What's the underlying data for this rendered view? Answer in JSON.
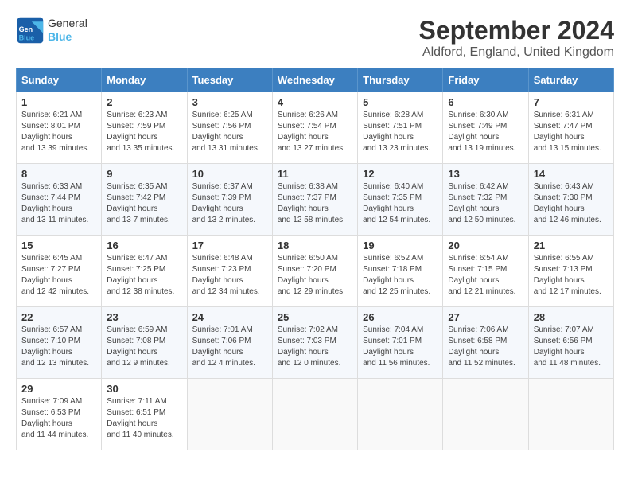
{
  "header": {
    "logo_line1": "General",
    "logo_line2": "Blue",
    "title": "September 2024",
    "subtitle": "Aldford, England, United Kingdom"
  },
  "calendar": {
    "days_of_week": [
      "Sunday",
      "Monday",
      "Tuesday",
      "Wednesday",
      "Thursday",
      "Friday",
      "Saturday"
    ],
    "weeks": [
      [
        {
          "day": "1",
          "sunrise": "6:21 AM",
          "sunset": "8:01 PM",
          "daylight": "13 hours and 39 minutes."
        },
        {
          "day": "2",
          "sunrise": "6:23 AM",
          "sunset": "7:59 PM",
          "daylight": "13 hours and 35 minutes."
        },
        {
          "day": "3",
          "sunrise": "6:25 AM",
          "sunset": "7:56 PM",
          "daylight": "13 hours and 31 minutes."
        },
        {
          "day": "4",
          "sunrise": "6:26 AM",
          "sunset": "7:54 PM",
          "daylight": "13 hours and 27 minutes."
        },
        {
          "day": "5",
          "sunrise": "6:28 AM",
          "sunset": "7:51 PM",
          "daylight": "13 hours and 23 minutes."
        },
        {
          "day": "6",
          "sunrise": "6:30 AM",
          "sunset": "7:49 PM",
          "daylight": "13 hours and 19 minutes."
        },
        {
          "day": "7",
          "sunrise": "6:31 AM",
          "sunset": "7:47 PM",
          "daylight": "13 hours and 15 minutes."
        }
      ],
      [
        {
          "day": "8",
          "sunrise": "6:33 AM",
          "sunset": "7:44 PM",
          "daylight": "13 hours and 11 minutes."
        },
        {
          "day": "9",
          "sunrise": "6:35 AM",
          "sunset": "7:42 PM",
          "daylight": "13 hours and 7 minutes."
        },
        {
          "day": "10",
          "sunrise": "6:37 AM",
          "sunset": "7:39 PM",
          "daylight": "13 hours and 2 minutes."
        },
        {
          "day": "11",
          "sunrise": "6:38 AM",
          "sunset": "7:37 PM",
          "daylight": "12 hours and 58 minutes."
        },
        {
          "day": "12",
          "sunrise": "6:40 AM",
          "sunset": "7:35 PM",
          "daylight": "12 hours and 54 minutes."
        },
        {
          "day": "13",
          "sunrise": "6:42 AM",
          "sunset": "7:32 PM",
          "daylight": "12 hours and 50 minutes."
        },
        {
          "day": "14",
          "sunrise": "6:43 AM",
          "sunset": "7:30 PM",
          "daylight": "12 hours and 46 minutes."
        }
      ],
      [
        {
          "day": "15",
          "sunrise": "6:45 AM",
          "sunset": "7:27 PM",
          "daylight": "12 hours and 42 minutes."
        },
        {
          "day": "16",
          "sunrise": "6:47 AM",
          "sunset": "7:25 PM",
          "daylight": "12 hours and 38 minutes."
        },
        {
          "day": "17",
          "sunrise": "6:48 AM",
          "sunset": "7:23 PM",
          "daylight": "12 hours and 34 minutes."
        },
        {
          "day": "18",
          "sunrise": "6:50 AM",
          "sunset": "7:20 PM",
          "daylight": "12 hours and 29 minutes."
        },
        {
          "day": "19",
          "sunrise": "6:52 AM",
          "sunset": "7:18 PM",
          "daylight": "12 hours and 25 minutes."
        },
        {
          "day": "20",
          "sunrise": "6:54 AM",
          "sunset": "7:15 PM",
          "daylight": "12 hours and 21 minutes."
        },
        {
          "day": "21",
          "sunrise": "6:55 AM",
          "sunset": "7:13 PM",
          "daylight": "12 hours and 17 minutes."
        }
      ],
      [
        {
          "day": "22",
          "sunrise": "6:57 AM",
          "sunset": "7:10 PM",
          "daylight": "12 hours and 13 minutes."
        },
        {
          "day": "23",
          "sunrise": "6:59 AM",
          "sunset": "7:08 PM",
          "daylight": "12 hours and 9 minutes."
        },
        {
          "day": "24",
          "sunrise": "7:01 AM",
          "sunset": "7:06 PM",
          "daylight": "12 hours and 4 minutes."
        },
        {
          "day": "25",
          "sunrise": "7:02 AM",
          "sunset": "7:03 PM",
          "daylight": "12 hours and 0 minutes."
        },
        {
          "day": "26",
          "sunrise": "7:04 AM",
          "sunset": "7:01 PM",
          "daylight": "11 hours and 56 minutes."
        },
        {
          "day": "27",
          "sunrise": "7:06 AM",
          "sunset": "6:58 PM",
          "daylight": "11 hours and 52 minutes."
        },
        {
          "day": "28",
          "sunrise": "7:07 AM",
          "sunset": "6:56 PM",
          "daylight": "11 hours and 48 minutes."
        }
      ],
      [
        {
          "day": "29",
          "sunrise": "7:09 AM",
          "sunset": "6:53 PM",
          "daylight": "11 hours and 44 minutes."
        },
        {
          "day": "30",
          "sunrise": "7:11 AM",
          "sunset": "6:51 PM",
          "daylight": "11 hours and 40 minutes."
        },
        null,
        null,
        null,
        null,
        null
      ]
    ]
  }
}
